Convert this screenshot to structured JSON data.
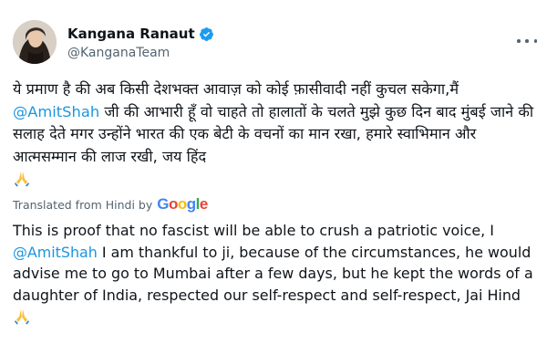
{
  "author": {
    "display_name": "Kangana Ranaut",
    "handle": "@KanganaTeam",
    "verified_icon": "verified-badge-icon"
  },
  "tweet": {
    "hindi_text_1": "ये प्रमाण है की अब किसी देशभक्त आवाज़ को कोई फ़ासीवादी नहीं कुचल सकेगा,मैं ",
    "hindi_mention": "@AmitShah",
    "hindi_text_2": " जी की आभारी हूँ वो चाहते तो हालातों के चलते मुझे कुछ दिन बाद मुंबई जाने की सलाह देते मगर उन्होंने भारत की एक बेटी के वचनों का मान रखा, हमारे स्वाभिमान और आत्मसम्मान की लाज रखी, जय हिंद",
    "translated_from": "Translated from Hindi by",
    "translator_brand": [
      "G",
      "o",
      "o",
      "g",
      "l",
      "e"
    ],
    "english_text_1": "This is proof that no fascist will be able to crush a patriotic voice, I ",
    "english_mention": "@AmitShah",
    "english_text_2": " I am thankful to ji, because of the circumstances, he would advise me to go to Mumbai after a few days, but he kept the words of a daughter of India, respected our self-respect and self-respect, Jai Hind "
  },
  "colors": {
    "mention": "#1b95e0",
    "verified": "#1d9bf0",
    "secondary_text": "#536471"
  }
}
